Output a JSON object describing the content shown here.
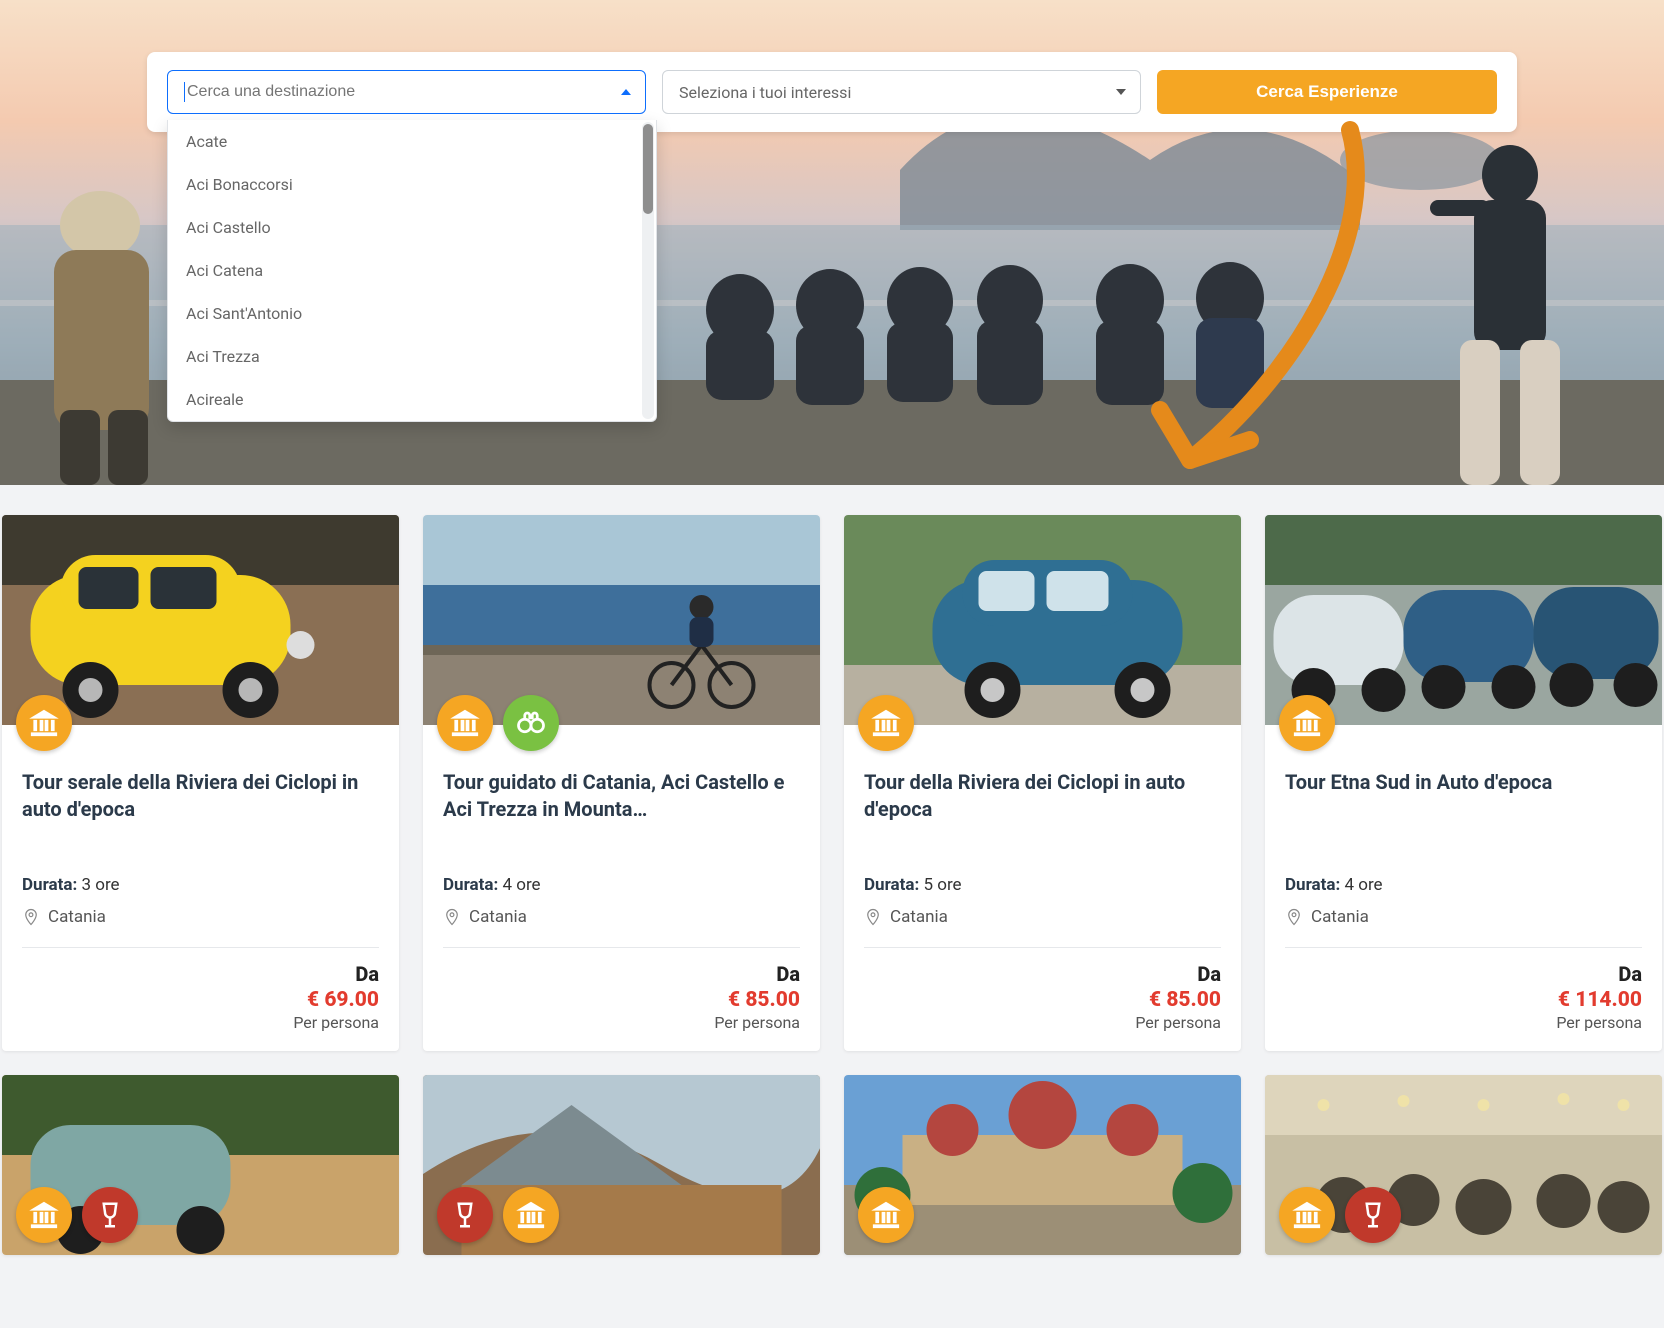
{
  "search": {
    "destination_placeholder": "Cerca una destinazione",
    "interests_placeholder": "Seleziona i tuoi interessi",
    "button_label": "Cerca Esperienze",
    "destination_options": [
      "Acate",
      "Aci Bonaccorsi",
      "Aci Castello",
      "Aci Catena",
      "Aci Sant'Antonio",
      "Aci Trezza",
      "Acireale"
    ]
  },
  "labels": {
    "duration": "Durata:",
    "from": "Da",
    "per_person": "Per persona"
  },
  "cards": [
    {
      "title": "Tour serale della Riviera dei Ciclopi in auto d'epoca",
      "duration": "3 ore",
      "location": "Catania",
      "price": "€ 69.00",
      "badges": [
        "museum"
      ]
    },
    {
      "title": "Tour guidato di Catania, Aci Castello e Aci Trezza in Mounta…",
      "duration": "4 ore",
      "location": "Catania",
      "price": "€ 85.00",
      "badges": [
        "museum",
        "binoculars"
      ]
    },
    {
      "title": "Tour della Riviera dei Ciclopi in auto d'epoca",
      "duration": "5 ore",
      "location": "Catania",
      "price": "€ 85.00",
      "badges": [
        "museum"
      ]
    },
    {
      "title": "Tour Etna Sud in Auto d'epoca",
      "duration": "4 ore",
      "location": "Catania",
      "price": "€ 114.00",
      "badges": [
        "museum"
      ]
    }
  ],
  "cards_row2": [
    {
      "badges": [
        "museum",
        "wine"
      ]
    },
    {
      "badges": [
        "wine",
        "museum"
      ]
    },
    {
      "badges": [
        "museum"
      ]
    },
    {
      "badges": [
        "museum",
        "wine"
      ]
    }
  ],
  "colors": {
    "accent_orange": "#f5a623",
    "accent_green": "#7ac142",
    "accent_red": "#c0392b",
    "price_red": "#e23b2e",
    "link_blue": "#0d6efd"
  }
}
